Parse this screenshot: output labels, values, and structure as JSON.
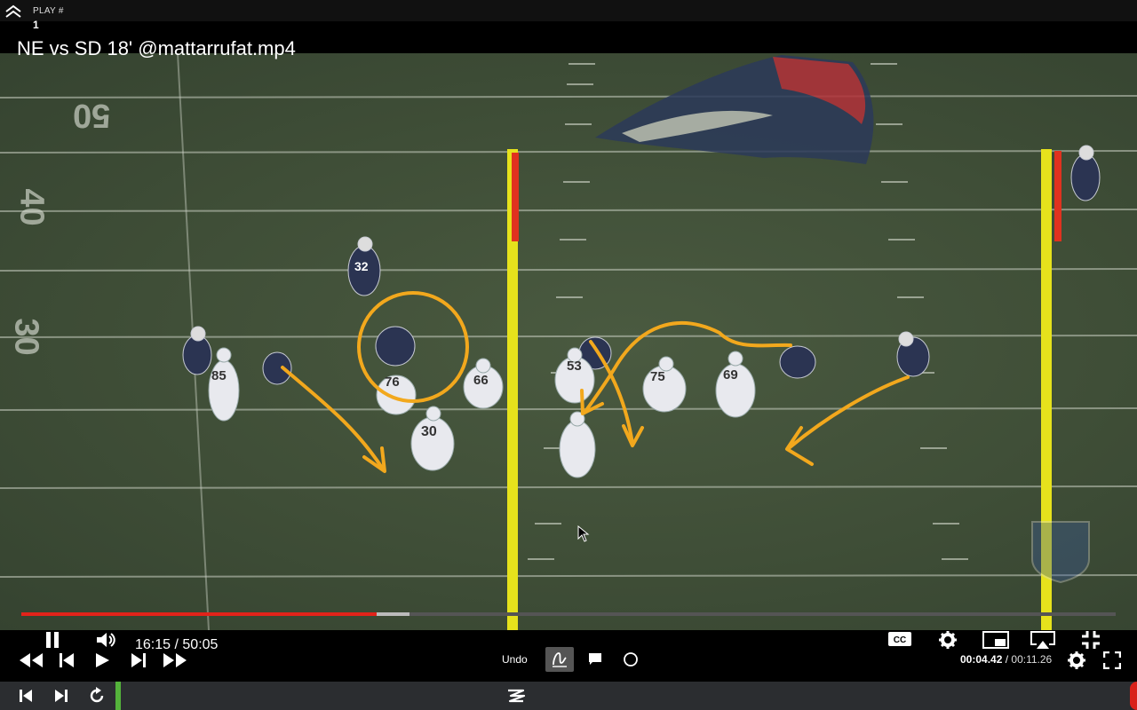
{
  "header": {
    "play_label": "PLAY #",
    "play_number": "1",
    "video_title": "NE vs SD 18' @mattarrufat.mp4"
  },
  "field": {
    "yard_numbers": [
      "50",
      "40",
      "30"
    ],
    "jersey_numbers": [
      "32",
      "85",
      "76",
      "66",
      "30",
      "53",
      "75",
      "69"
    ],
    "watermark": "NFL"
  },
  "player": {
    "current_time": "16:15",
    "duration": "50:05",
    "time_separator": " / ",
    "progress_fraction": 0.3246,
    "buffered_fraction": 0.355
  },
  "annotation_tools": {
    "undo_label": "Undo",
    "active_tool": "freehand-draw"
  },
  "clip": {
    "current": "00:04.42",
    "total": "00:11.26",
    "separator": " / "
  },
  "colors": {
    "progress": "#e2231a",
    "annotation": "#f2a81d",
    "goalpost": "#e6e21c",
    "timeline_marker": "#54b33b"
  }
}
